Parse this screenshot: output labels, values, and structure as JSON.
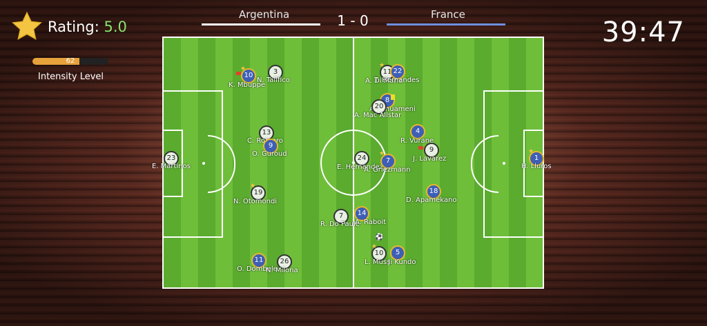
{
  "header": {
    "home_team": "Argentina",
    "away_team": "France",
    "score": "1 - 0",
    "home_color": "#ffffff",
    "away_color": "#6f8fe0"
  },
  "rating": {
    "label": "Rating:",
    "value": "5.0",
    "icon": "star-icon"
  },
  "intensity": {
    "value": "62",
    "fraction": 0.62,
    "label": "Intensity Level"
  },
  "clock": "39:47",
  "players": [
    {
      "team": "arg",
      "number": "10",
      "name": "K. Mbuppe"
    },
    {
      "team": "arg",
      "number": "3",
      "name": "N. Tailfico"
    },
    {
      "team": "arg",
      "number": "13",
      "name": "C. Romero"
    },
    {
      "team": "fra",
      "number": "9",
      "name": "O. Guroud"
    },
    {
      "team": "arg",
      "number": "23",
      "name": "E. Martinos"
    },
    {
      "team": "arg",
      "number": "19",
      "name": "N. Otomondi"
    },
    {
      "team": "fra",
      "number": "11",
      "name": "O. Dombele"
    },
    {
      "team": "arg",
      "number": "26",
      "name": "N. Milona"
    },
    {
      "team": "arg",
      "number": "11",
      "name": "A. Di Maria"
    },
    {
      "team": "fra",
      "number": "22",
      "name": "T. Hernandes"
    },
    {
      "team": "fra",
      "number": "8",
      "name": "A. Tchuameni"
    },
    {
      "team": "arg",
      "number": "20",
      "name": "A. Mac Allstar"
    },
    {
      "team": "fra",
      "number": "4",
      "name": "R. Vurane"
    },
    {
      "team": "arg",
      "number": "9",
      "name": "J. Lavarez"
    },
    {
      "team": "arg",
      "number": "24",
      "name": "E. Hernandez"
    },
    {
      "team": "fra",
      "number": "7",
      "name": "A. Griezmann"
    },
    {
      "team": "fra",
      "number": "18",
      "name": "D. Apamekano"
    },
    {
      "team": "arg",
      "number": "7",
      "name": "R. Do Paule"
    },
    {
      "team": "fra",
      "number": "14",
      "name": "A. Raboit"
    },
    {
      "team": "arg",
      "number": "10",
      "name": "L. Mussi"
    },
    {
      "team": "fra",
      "number": "5",
      "name": "J. Kundo"
    },
    {
      "team": "fra",
      "number": "1",
      "name": "H. Lluros"
    }
  ]
}
